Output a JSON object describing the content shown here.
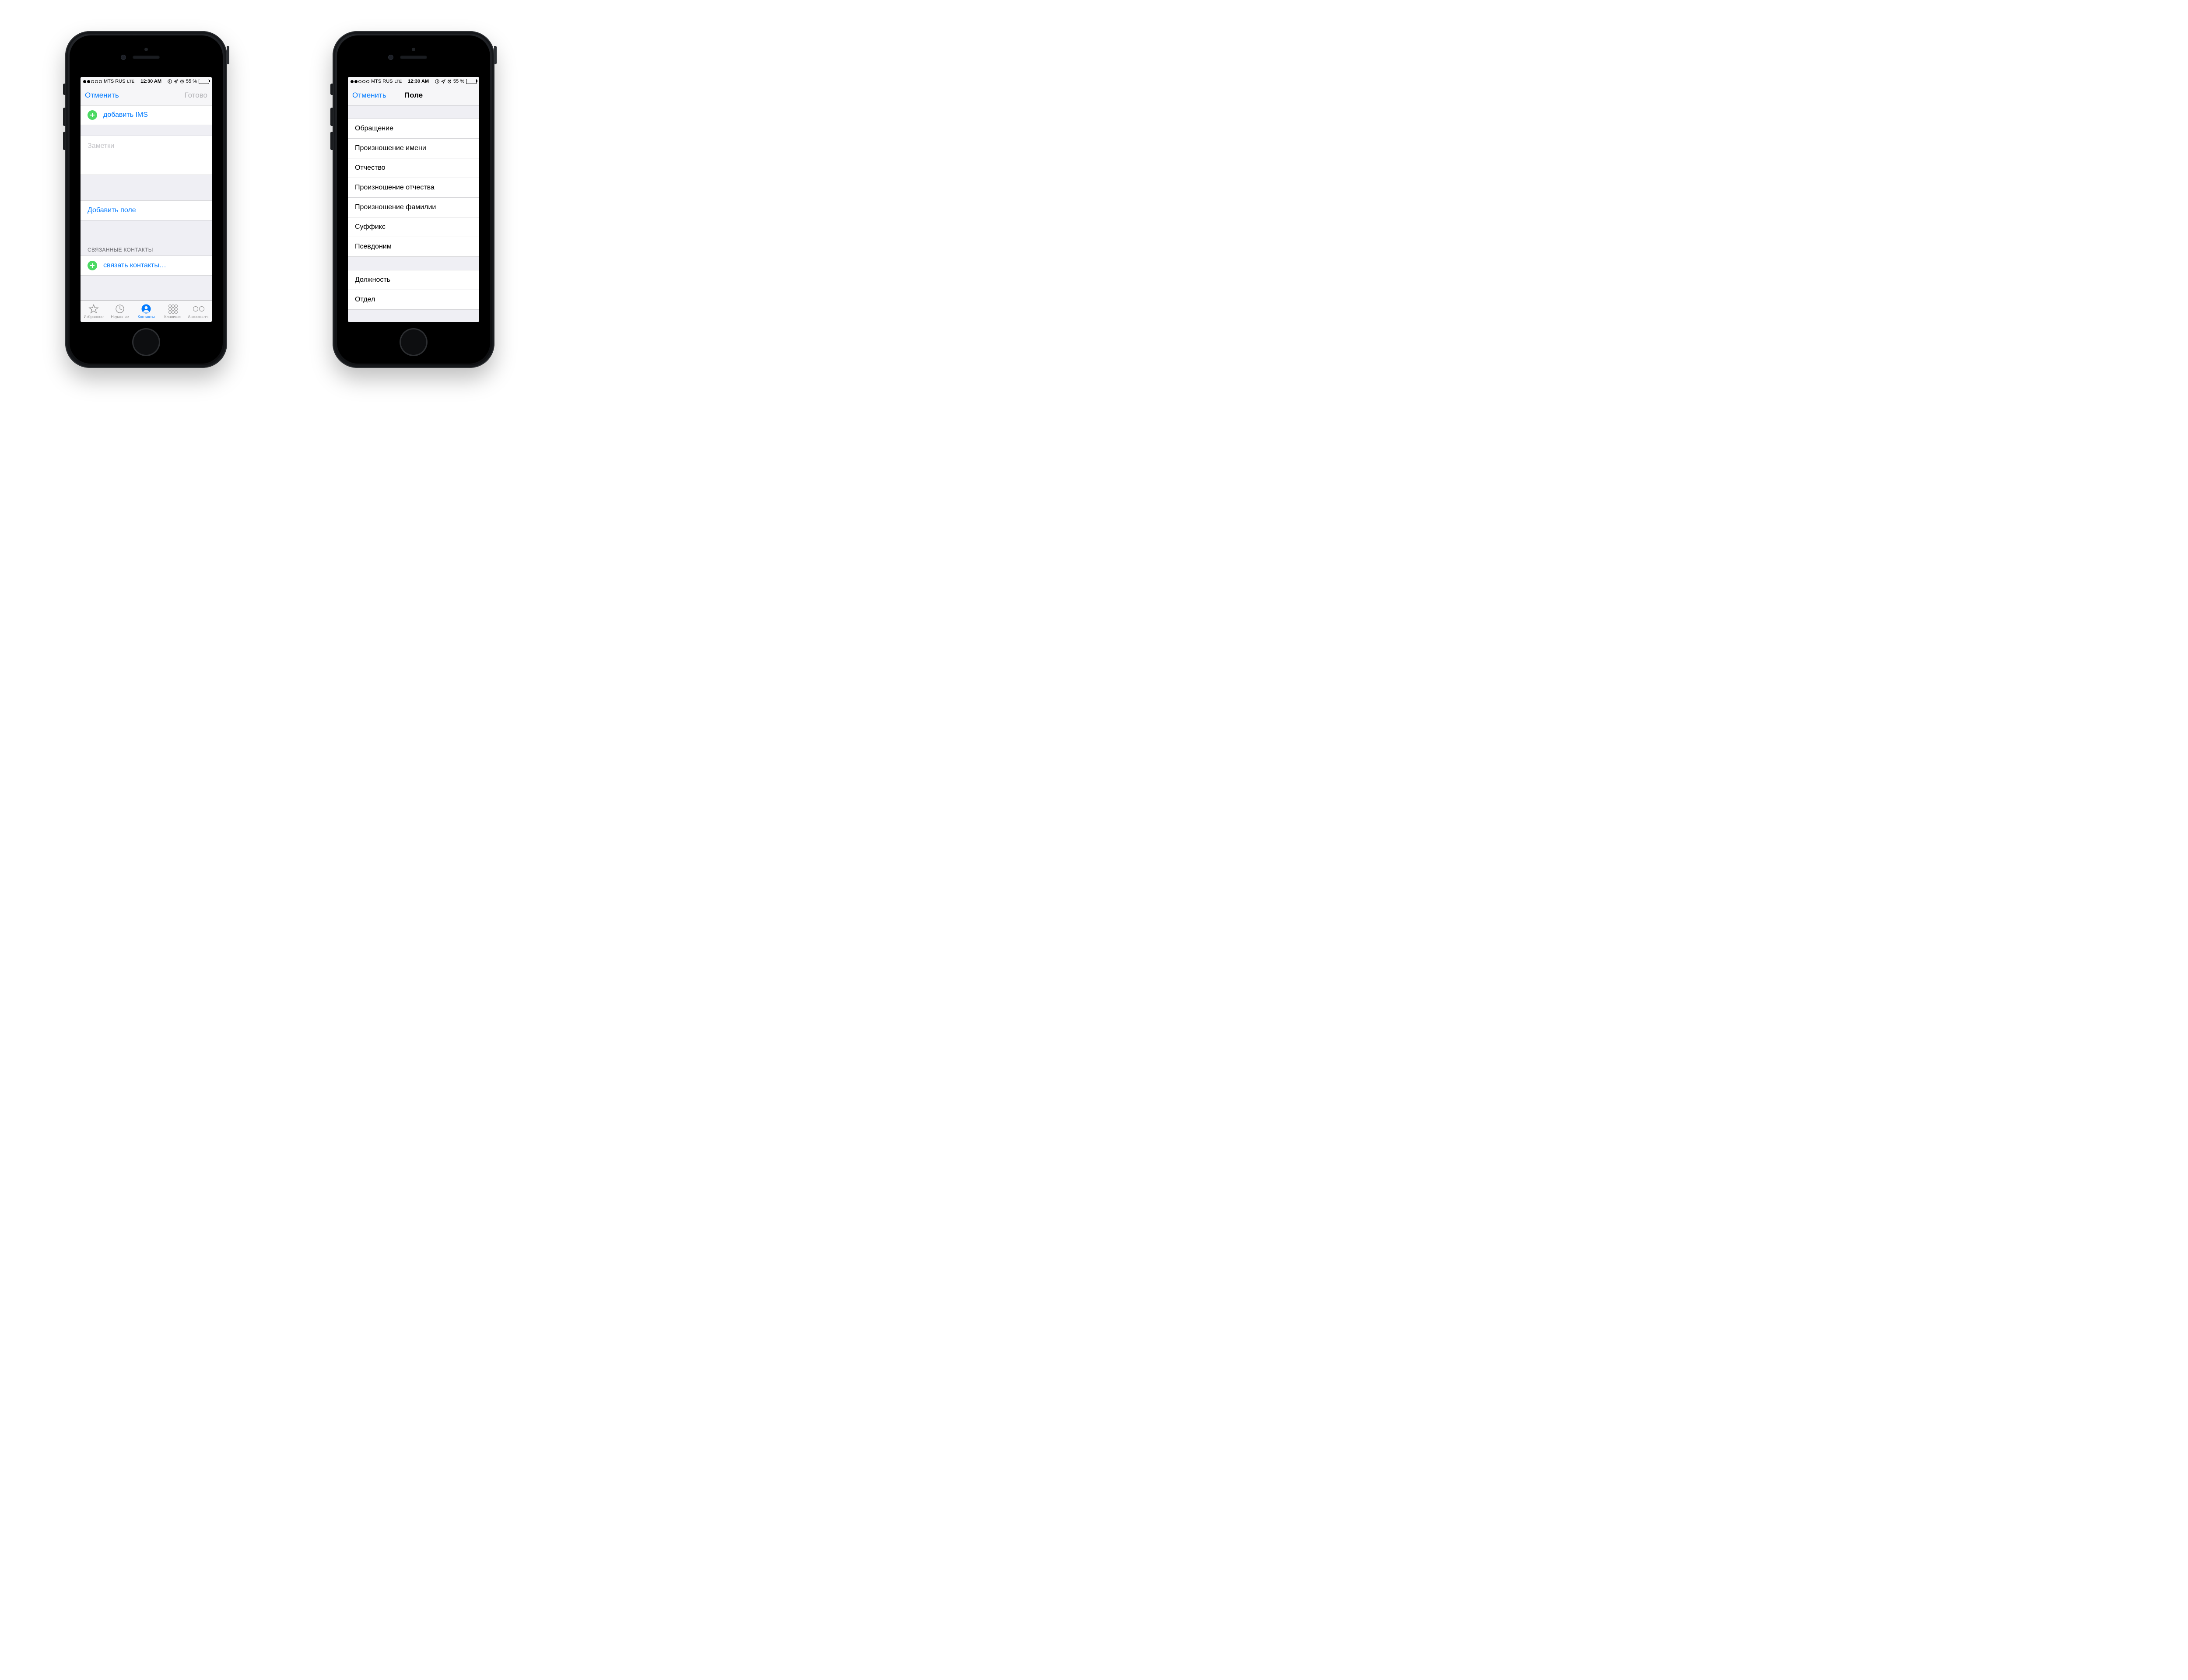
{
  "status_bar": {
    "carrier": "MTS RUS",
    "network_label": "LTE",
    "time": "12:30 AM",
    "battery_text": "55 %",
    "battery_level": 55,
    "signal_strength": 2
  },
  "colors": {
    "ios_blue": "#007aff",
    "ios_green": "#4cd964",
    "placeholder": "#c4c4c8",
    "group_bg": "#efeff4"
  },
  "screen1": {
    "nav": {
      "cancel": "Отменить",
      "done": "Готово"
    },
    "add_ims_label": "добавить IMS",
    "notes_placeholder": "Заметки",
    "add_field_label": "Добавить поле",
    "linked_header": "СВЯЗАННЫЕ КОНТАКТЫ",
    "link_contacts_label": "связать контакты…",
    "tabs": [
      {
        "id": "favorites",
        "label": "Избранное"
      },
      {
        "id": "recents",
        "label": "Недавние"
      },
      {
        "id": "contacts",
        "label": "Контакты"
      },
      {
        "id": "keypad",
        "label": "Клавиши"
      },
      {
        "id": "voicemail",
        "label": "Автоответч."
      }
    ],
    "active_tab": "contacts"
  },
  "screen2": {
    "nav": {
      "cancel": "Отменить",
      "title": "Поле"
    },
    "group1": [
      "Обращение",
      "Произношение имени",
      "Отчество",
      "Произношение отчества",
      "Произношение фамилии",
      "Суффикс",
      "Псевдоним"
    ],
    "group2": [
      "Должность",
      "Отдел"
    ]
  }
}
